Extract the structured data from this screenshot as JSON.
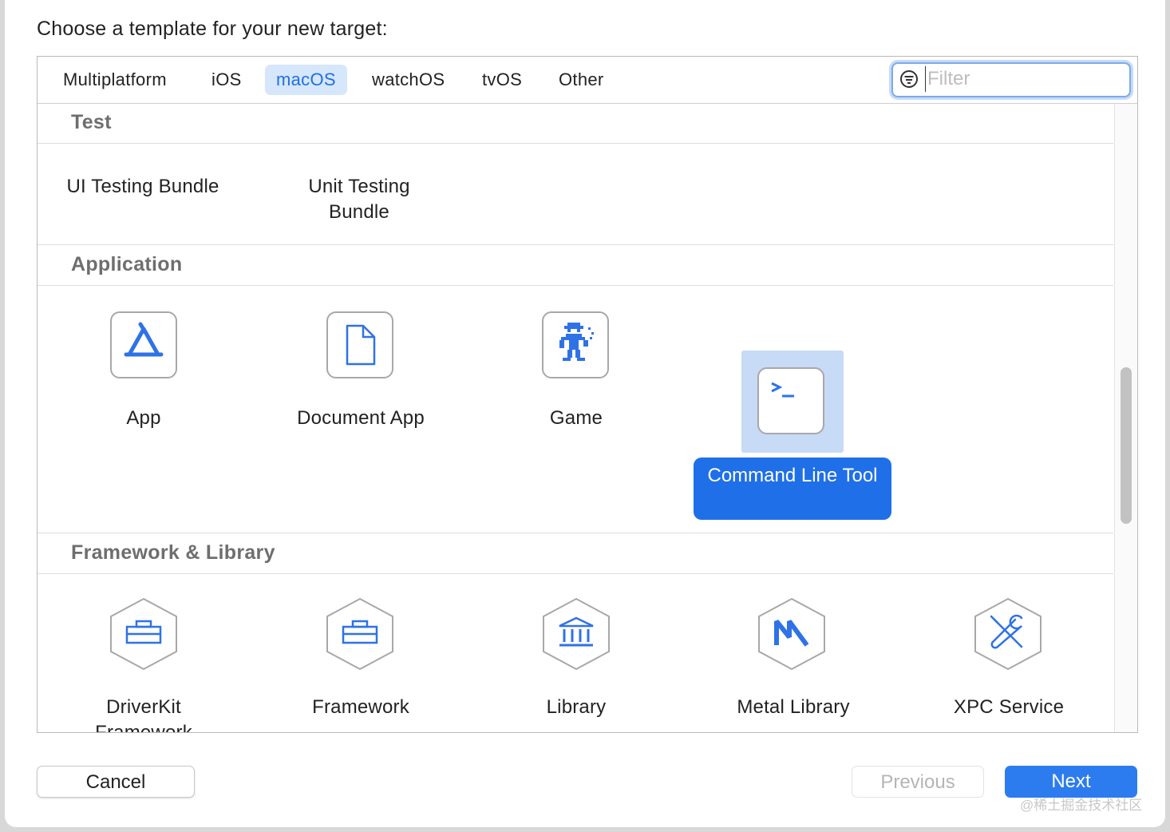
{
  "dialog": {
    "prompt": "Choose a template for your new target:"
  },
  "tabs": [
    {
      "label": "Multiplatform",
      "active": false
    },
    {
      "label": "iOS",
      "active": false
    },
    {
      "label": "macOS",
      "active": true
    },
    {
      "label": "watchOS",
      "active": false
    },
    {
      "label": "tvOS",
      "active": false
    },
    {
      "label": "Other",
      "active": false
    }
  ],
  "filter": {
    "placeholder": "Filter",
    "value": ""
  },
  "sections": {
    "test": {
      "title": "Test",
      "items": [
        {
          "label": "UI Testing Bundle"
        },
        {
          "label": "Unit Testing Bundle"
        }
      ]
    },
    "application": {
      "title": "Application",
      "items": [
        {
          "label": "App",
          "icon": "app-store-icon"
        },
        {
          "label": "Document App",
          "icon": "document-icon"
        },
        {
          "label": "Game",
          "icon": "game-character-icon"
        },
        {
          "label": "Command Line Tool",
          "icon": "terminal-icon",
          "selected": true
        }
      ]
    },
    "framework": {
      "title": "Framework & Library",
      "items": [
        {
          "label": "DriverKit Framework",
          "icon": "toolbox-icon"
        },
        {
          "label": "Framework",
          "icon": "toolbox-icon"
        },
        {
          "label": "Library",
          "icon": "library-building-icon"
        },
        {
          "label": "Metal Library",
          "icon": "metal-icon"
        },
        {
          "label": "XPC Service",
          "icon": "tools-icon"
        }
      ]
    }
  },
  "buttons": {
    "cancel": "Cancel",
    "previous": "Previous",
    "next": "Next"
  },
  "watermark": "@稀土掘金技术社区",
  "colors": {
    "accent": "#1f6fe8",
    "icon_blue": "#2f72e6",
    "selected_bg": "#c7daf6"
  }
}
